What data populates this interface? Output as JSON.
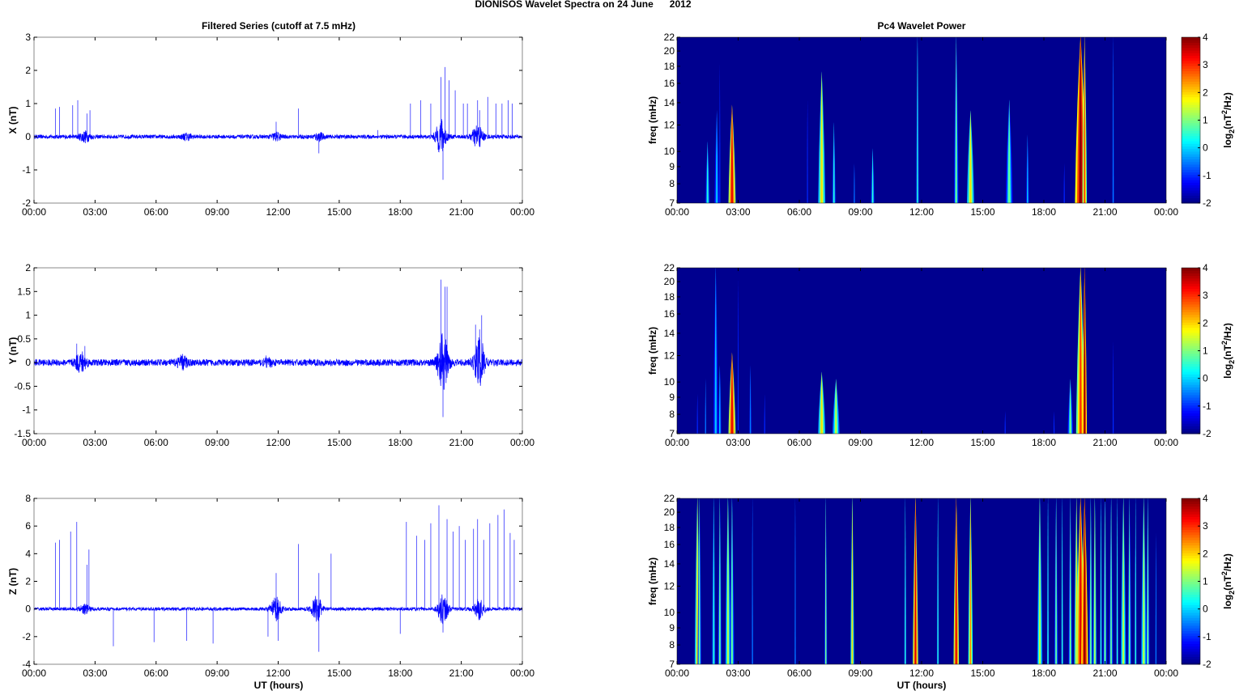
{
  "title": "DIONISOS Wavelet Spectra on 24 June      2012",
  "left_title": "Filtered Series (cutoff at 7.5 mHz)",
  "right_title": "Pc4 Wavelet Power",
  "xlabel": "UT (hours)",
  "colorbar": {
    "label_parts": [
      "log",
      "2",
      "(nT",
      "2",
      "/Hz)"
    ],
    "range": [
      -2,
      4
    ],
    "ticks": [
      "-2",
      "-1",
      "0",
      "1",
      "2",
      "3",
      "4"
    ]
  },
  "colors": {
    "trace": "#0000ff",
    "background": "#00008f"
  },
  "chart_data": [
    {
      "type": "line",
      "name": "X",
      "ylabel": "X (nT)",
      "ylim": [
        -2,
        3
      ],
      "yticks": [
        "-2",
        "-1",
        "0",
        "1",
        "2",
        "3"
      ],
      "xlim": [
        0,
        24
      ],
      "xticks": [
        "00:00",
        "03:00",
        "06:00",
        "09:00",
        "12:00",
        "15:00",
        "18:00",
        "21:00",
        "00:00"
      ],
      "noise_level": 0.06,
      "bursts": [
        [
          2.5,
          0.15
        ],
        [
          7.5,
          0.08
        ],
        [
          20.0,
          0.5
        ],
        [
          21.8,
          0.35
        ],
        [
          11.9,
          0.1
        ],
        [
          14.0,
          0.1
        ]
      ],
      "spikes": [
        [
          1.05,
          0.85
        ],
        [
          1.25,
          0.9
        ],
        [
          1.9,
          0.95
        ],
        [
          2.15,
          1.1
        ],
        [
          2.6,
          0.7
        ],
        [
          2.75,
          0.8
        ],
        [
          11.9,
          0.45
        ],
        [
          13.0,
          0.85
        ],
        [
          14.0,
          -0.5
        ],
        [
          16.9,
          0.2
        ],
        [
          18.5,
          1.0
        ],
        [
          19.0,
          1.1
        ],
        [
          19.5,
          1.0
        ],
        [
          20.0,
          1.8
        ],
        [
          20.1,
          -1.3
        ],
        [
          20.2,
          2.1
        ],
        [
          20.4,
          1.7
        ],
        [
          20.7,
          1.4
        ],
        [
          21.1,
          1.0
        ],
        [
          21.3,
          1.0
        ],
        [
          21.8,
          1.1
        ],
        [
          21.9,
          0.8
        ],
        [
          22.3,
          1.2
        ],
        [
          22.7,
          1.0
        ],
        [
          23.0,
          1.0
        ],
        [
          23.3,
          1.1
        ],
        [
          23.5,
          1.0
        ]
      ]
    },
    {
      "type": "line",
      "name": "Y",
      "ylabel": "Y (nT)",
      "ylim": [
        -1.5,
        2
      ],
      "yticks": [
        "-1.5",
        "-1",
        "-0.5",
        "0",
        "0.5",
        "1",
        "1.5",
        "2"
      ],
      "xlim": [
        0,
        24
      ],
      "xticks": [
        "00:00",
        "03:00",
        "06:00",
        "09:00",
        "12:00",
        "15:00",
        "18:00",
        "21:00",
        "00:00"
      ],
      "noise_level": 0.07,
      "bursts": [
        [
          2.3,
          0.2
        ],
        [
          7.3,
          0.12
        ],
        [
          20.1,
          0.6
        ],
        [
          21.9,
          0.5
        ],
        [
          11.5,
          0.05
        ]
      ],
      "spikes": [
        [
          2.1,
          0.4
        ],
        [
          2.5,
          0.35
        ],
        [
          11.4,
          0.15
        ],
        [
          20.0,
          1.75
        ],
        [
          20.1,
          -1.15
        ],
        [
          20.2,
          1.6
        ],
        [
          20.3,
          1.6
        ],
        [
          21.7,
          0.8
        ],
        [
          21.9,
          0.7
        ],
        [
          22.0,
          1.0
        ]
      ]
    },
    {
      "type": "line",
      "name": "Z",
      "ylabel": "Z (nT)",
      "ylim": [
        -4,
        8
      ],
      "yticks": [
        "-4",
        "-2",
        "0",
        "2",
        "4",
        "6",
        "8"
      ],
      "xlim": [
        0,
        24
      ],
      "xticks": [
        "00:00",
        "03:00",
        "06:00",
        "09:00",
        "12:00",
        "15:00",
        "18:00",
        "21:00",
        "00:00"
      ],
      "noise_level": 0.12,
      "bursts": [
        [
          2.5,
          0.3
        ],
        [
          11.9,
          0.8
        ],
        [
          13.9,
          0.9
        ],
        [
          20.1,
          1.0
        ],
        [
          21.9,
          0.7
        ]
      ],
      "spikes": [
        [
          1.05,
          4.8
        ],
        [
          1.25,
          5.0
        ],
        [
          1.8,
          5.6
        ],
        [
          2.1,
          6.3
        ],
        [
          2.6,
          3.2
        ],
        [
          2.7,
          4.3
        ],
        [
          3.9,
          -2.7
        ],
        [
          5.9,
          -2.4
        ],
        [
          7.5,
          -2.3
        ],
        [
          8.8,
          -2.5
        ],
        [
          11.5,
          -2.0
        ],
        [
          11.9,
          2.6
        ],
        [
          12.0,
          -2.3
        ],
        [
          13.0,
          4.7
        ],
        [
          14.0,
          2.6
        ],
        [
          14.0,
          -3.1
        ],
        [
          14.6,
          4.0
        ],
        [
          18.0,
          -1.8
        ],
        [
          18.3,
          6.3
        ],
        [
          18.8,
          5.3
        ],
        [
          19.2,
          5.0
        ],
        [
          19.5,
          6.2
        ],
        [
          19.9,
          7.5
        ],
        [
          20.1,
          -1.7
        ],
        [
          20.3,
          6.5
        ],
        [
          20.6,
          5.6
        ],
        [
          20.9,
          6.0
        ],
        [
          21.2,
          5.0
        ],
        [
          21.6,
          5.8
        ],
        [
          21.8,
          6.5
        ],
        [
          22.1,
          5.0
        ],
        [
          22.4,
          6.2
        ],
        [
          22.8,
          6.8
        ],
        [
          23.1,
          7.2
        ],
        [
          23.4,
          5.5
        ],
        [
          23.6,
          5.0
        ]
      ]
    },
    {
      "type": "heatmap",
      "name": "X wavelet",
      "ylabel": "freq (mHz)",
      "ylim": [
        7,
        22
      ],
      "yscale": "log",
      "yticks": [
        "7",
        "8",
        "9",
        "10",
        "12",
        "14",
        "16",
        "18",
        "20",
        "22"
      ],
      "xlim": [
        0,
        24
      ],
      "xticks": [
        "00:00",
        "03:00",
        "06:00",
        "09:00",
        "12:00",
        "15:00",
        "18:00",
        "21:00",
        "00:00"
      ],
      "events": [
        [
          1.5,
          10.5,
          0.12,
          0.5
        ],
        [
          1.95,
          13,
          0.16,
          0
        ],
        [
          2.1,
          18,
          0.06,
          -1
        ],
        [
          2.7,
          13.5,
          0.16,
          3.5
        ],
        [
          6.4,
          14,
          0.06,
          -1
        ],
        [
          7.1,
          17,
          0.16,
          2
        ],
        [
          7.7,
          12,
          0.1,
          0.5
        ],
        [
          8.7,
          9,
          0.06,
          -0.5
        ],
        [
          9.6,
          10,
          0.1,
          0.5
        ],
        [
          11.8,
          22,
          0.08,
          0.5
        ],
        [
          13.7,
          22,
          0.1,
          1
        ],
        [
          14.4,
          13,
          0.16,
          2
        ],
        [
          16.3,
          14,
          0.16,
          1
        ],
        [
          17.2,
          11,
          0.1,
          0
        ],
        [
          19.0,
          9,
          0.08,
          -1
        ],
        [
          19.8,
          22,
          0.25,
          4
        ],
        [
          20.0,
          22,
          0.1,
          3
        ],
        [
          21.4,
          22,
          0.08,
          -0.5
        ]
      ]
    },
    {
      "type": "heatmap",
      "name": "Y wavelet",
      "ylabel": "freq (mHz)",
      "ylim": [
        7,
        22
      ],
      "yscale": "log",
      "yticks": [
        "7",
        "8",
        "9",
        "10",
        "12",
        "14",
        "16",
        "18",
        "20",
        "22"
      ],
      "xlim": [
        0,
        24
      ],
      "xticks": [
        "00:00",
        "03:00",
        "06:00",
        "09:00",
        "12:00",
        "15:00",
        "18:00",
        "21:00",
        "00:00"
      ],
      "events": [
        [
          1.0,
          9,
          0.05,
          -1
        ],
        [
          1.4,
          10,
          0.05,
          -0.5
        ],
        [
          1.9,
          22,
          0.16,
          0
        ],
        [
          2.1,
          11,
          0.1,
          0
        ],
        [
          2.7,
          12,
          0.16,
          3.5
        ],
        [
          3.0,
          20,
          0.05,
          -1
        ],
        [
          3.6,
          11,
          0.1,
          -0.5
        ],
        [
          4.3,
          9,
          0.06,
          -1
        ],
        [
          7.1,
          10.5,
          0.16,
          2
        ],
        [
          7.8,
          10,
          0.16,
          1.5
        ],
        [
          16.1,
          8,
          0.05,
          -1
        ],
        [
          18.5,
          8,
          0.05,
          -1
        ],
        [
          19.3,
          10,
          0.12,
          1
        ],
        [
          19.8,
          22,
          0.2,
          3
        ],
        [
          20.0,
          22,
          0.1,
          4
        ],
        [
          21.4,
          13,
          0.05,
          -1
        ]
      ]
    },
    {
      "type": "heatmap",
      "name": "Z wavelet",
      "ylabel": "freq (mHz)",
      "ylim": [
        7,
        22
      ],
      "yscale": "log",
      "yticks": [
        "7",
        "8",
        "9",
        "10",
        "12",
        "14",
        "16",
        "18",
        "20",
        "22"
      ],
      "xlim": [
        0,
        24
      ],
      "xticks": [
        "00:00",
        "03:00",
        "06:00",
        "09:00",
        "12:00",
        "15:00",
        "18:00",
        "21:00",
        "00:00"
      ],
      "events": [
        [
          1.0,
          22,
          0.12,
          2
        ],
        [
          1.1,
          22,
          0.08,
          1
        ],
        [
          1.8,
          22,
          0.1,
          0.5
        ],
        [
          2.1,
          22,
          0.08,
          1
        ],
        [
          2.5,
          22,
          0.12,
          1.5
        ],
        [
          2.7,
          22,
          0.1,
          1
        ],
        [
          3.7,
          22,
          0.05,
          -0.5
        ],
        [
          5.8,
          22,
          0.05,
          -0.5
        ],
        [
          7.3,
          22,
          0.06,
          1
        ],
        [
          8.6,
          22,
          0.08,
          2
        ],
        [
          11.2,
          22,
          0.06,
          0.5
        ],
        [
          11.7,
          22,
          0.12,
          3.5
        ],
        [
          12.8,
          22,
          0.06,
          0.5
        ],
        [
          13.7,
          22,
          0.12,
          3.5
        ],
        [
          14.4,
          22,
          0.1,
          2.5
        ],
        [
          17.8,
          22,
          0.12,
          1.5
        ],
        [
          18.2,
          22,
          0.06,
          0.5
        ],
        [
          18.6,
          22,
          0.08,
          1
        ],
        [
          18.9,
          22,
          0.06,
          0.5
        ],
        [
          19.3,
          22,
          0.08,
          1
        ],
        [
          19.6,
          22,
          0.1,
          2
        ],
        [
          19.8,
          22,
          0.2,
          3.5
        ],
        [
          20.0,
          22,
          0.15,
          4
        ],
        [
          20.3,
          22,
          0.08,
          1
        ],
        [
          20.5,
          22,
          0.08,
          1.5
        ],
        [
          20.8,
          22,
          0.06,
          0.5
        ],
        [
          21.0,
          22,
          0.08,
          1
        ],
        [
          21.3,
          22,
          0.08,
          1
        ],
        [
          21.6,
          22,
          0.06,
          0.5
        ],
        [
          21.9,
          22,
          0.12,
          1.5
        ],
        [
          22.2,
          22,
          0.08,
          1
        ],
        [
          22.5,
          22,
          0.06,
          0.5
        ],
        [
          22.9,
          22,
          0.12,
          1.5
        ],
        [
          23.1,
          22,
          0.08,
          1
        ],
        [
          23.5,
          17,
          0.05,
          -0.5
        ]
      ]
    }
  ]
}
